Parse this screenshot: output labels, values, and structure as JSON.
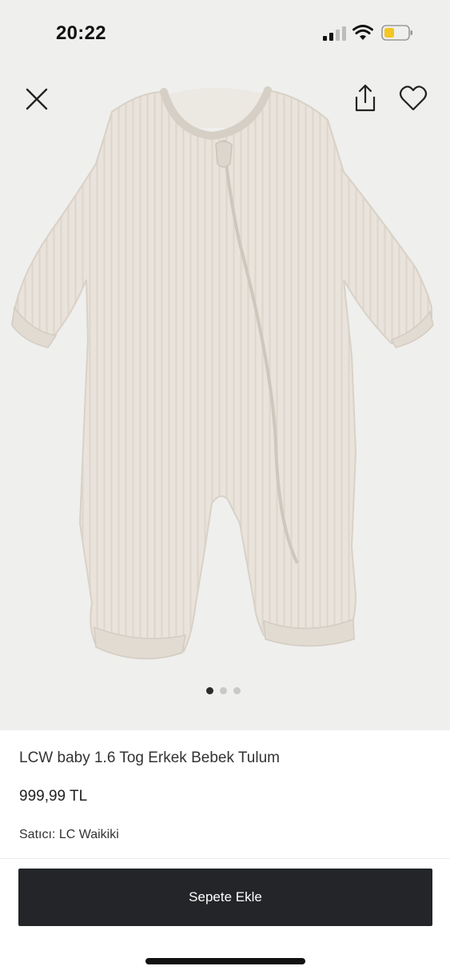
{
  "status_bar": {
    "time": "20:22",
    "icons": [
      "cellular-signal-icon",
      "wifi-icon",
      "battery-icon"
    ],
    "battery_color": "#f3c623"
  },
  "toolbar": {
    "icons": [
      "close-icon",
      "share-icon",
      "heart-icon"
    ]
  },
  "gallery": {
    "image_subject": "Beige ribbed baby jumpsuit with diagonal zipper",
    "total_images": 3,
    "active_index": 0
  },
  "product": {
    "title": "LCW baby 1.6 Tog Erkek Bebek Tulum",
    "price": "999,99 TL",
    "seller_label": "Satıcı:",
    "seller_name": "LC Waikiki"
  },
  "actions": {
    "add_to_cart_label": "Sepete Ekle"
  },
  "colors": {
    "hero_background": "#efefed",
    "button_background": "#232528",
    "garment": "#e8e2da"
  }
}
